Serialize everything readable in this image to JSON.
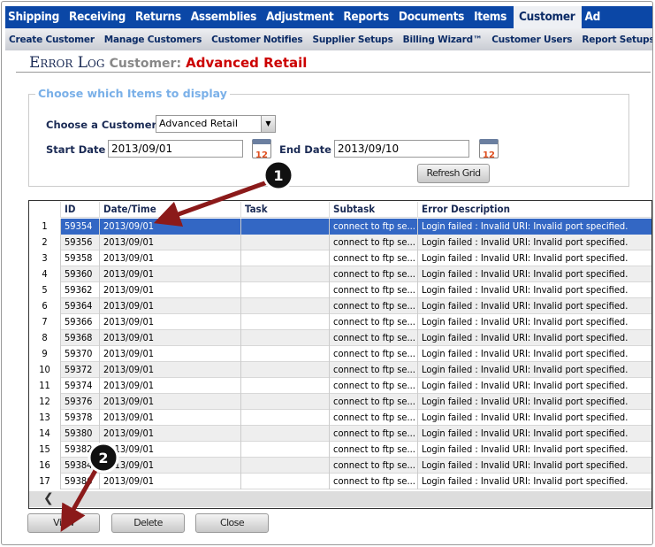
{
  "nav": {
    "items": [
      "Shipping",
      "Receiving",
      "Returns",
      "Assemblies",
      "Adjustment",
      "Reports",
      "Documents",
      "Items",
      "Customer",
      "Ad"
    ],
    "active": "Customer"
  },
  "subnav": {
    "items": [
      "Create Customer",
      "Manage Customers",
      "Customer Notifies",
      "Supplier Setups",
      "Billing Wizard™",
      "Customer Users",
      "Report Setups"
    ]
  },
  "page": {
    "title": "Error Log",
    "customer_label": "Customer:",
    "customer_name": "Advanced Retail"
  },
  "filters": {
    "legend": "Choose which Items to display",
    "customer_label": "Choose a Customer",
    "customer_value": "Advanced Retail",
    "start_label": "Start Date",
    "start_value": "2013/09/01",
    "end_label": "End Date",
    "end_value": "2013/09/10",
    "calendar_icon_text": "12",
    "refresh_label": "Refresh Grid"
  },
  "grid": {
    "columns": [
      "",
      "ID",
      "Date/Time",
      "Task",
      "Subtask",
      "Error Description"
    ],
    "rows": [
      [
        "1",
        "59354",
        "2013/09/01",
        "",
        "connect to ftp se...",
        "Login failed : Invalid URI: Invalid port specified."
      ],
      [
        "2",
        "59356",
        "2013/09/01",
        "",
        "connect to ftp se...",
        "Login failed : Invalid URI: Invalid port specified."
      ],
      [
        "3",
        "59358",
        "2013/09/01",
        "",
        "connect to ftp se...",
        "Login failed : Invalid URI: Invalid port specified."
      ],
      [
        "4",
        "59360",
        "2013/09/01",
        "",
        "connect to ftp se...",
        "Login failed : Invalid URI: Invalid port specified."
      ],
      [
        "5",
        "59362",
        "2013/09/01",
        "",
        "connect to ftp se...",
        "Login failed : Invalid URI: Invalid port specified."
      ],
      [
        "6",
        "59364",
        "2013/09/01",
        "",
        "connect to ftp se...",
        "Login failed : Invalid URI: Invalid port specified."
      ],
      [
        "7",
        "59366",
        "2013/09/01",
        "",
        "connect to ftp se...",
        "Login failed : Invalid URI: Invalid port specified."
      ],
      [
        "8",
        "59368",
        "2013/09/01",
        "",
        "connect to ftp se...",
        "Login failed : Invalid URI: Invalid port specified."
      ],
      [
        "9",
        "59370",
        "2013/09/01",
        "",
        "connect to ftp se...",
        "Login failed : Invalid URI: Invalid port specified."
      ],
      [
        "10",
        "59372",
        "2013/09/01",
        "",
        "connect to ftp se...",
        "Login failed : Invalid URI: Invalid port specified."
      ],
      [
        "11",
        "59374",
        "2013/09/01",
        "",
        "connect to ftp se...",
        "Login failed : Invalid URI: Invalid port specified."
      ],
      [
        "12",
        "59376",
        "2013/09/01",
        "",
        "connect to ftp se...",
        "Login failed : Invalid URI: Invalid port specified."
      ],
      [
        "13",
        "59378",
        "2013/09/01",
        "",
        "connect to ftp se...",
        "Login failed : Invalid URI: Invalid port specified."
      ],
      [
        "14",
        "59380",
        "2013/09/01",
        "",
        "connect to ftp se...",
        "Login failed : Invalid URI: Invalid port specified."
      ],
      [
        "15",
        "59382",
        "2013/09/01",
        "",
        "connect to ftp se...",
        "Login failed : Invalid URI: Invalid port specified."
      ],
      [
        "16",
        "59384",
        "2013/09/01",
        "",
        "connect to ftp se...",
        "Login failed : Invalid URI: Invalid port specified."
      ],
      [
        "17",
        "59386",
        "2013/09/01",
        "",
        "connect to ftp se...",
        "Login failed : Invalid URI: Invalid port specified."
      ]
    ],
    "selected_row": 1,
    "scroll_left_glyph": "❮"
  },
  "buttons": {
    "view": "View",
    "delete": "Delete",
    "close": "Close"
  },
  "annotations": [
    "1",
    "2"
  ],
  "colors": {
    "nav": "#0b47a6",
    "selected": "#3367c4",
    "title_accent": "#cc0000",
    "arrow": "#8b1a1a"
  }
}
